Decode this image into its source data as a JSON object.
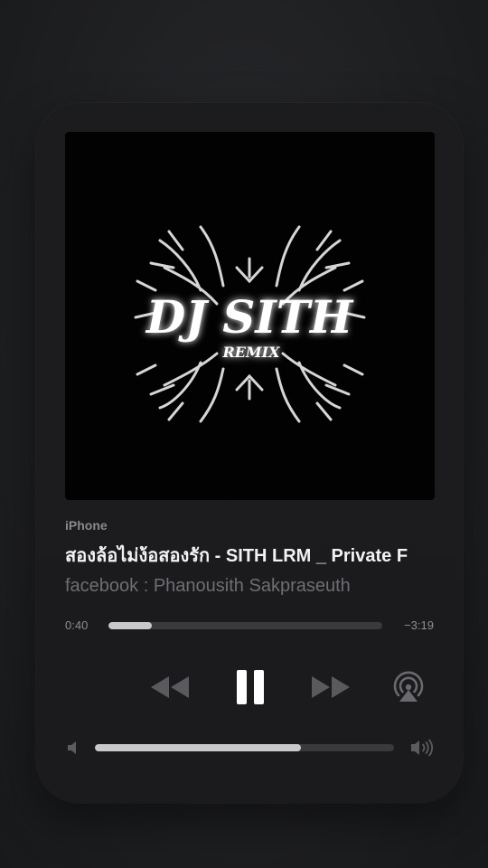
{
  "player": {
    "device_label": "iPhone",
    "track_title": "สองล้อไม่ง้อสองรัก - SITH LRM _ Private F",
    "artist": "facebook : Phanousith Sakpraseuth",
    "elapsed": "0:40",
    "remaining": "−3:19",
    "progress_fraction": 0.16,
    "volume_fraction": 0.69
  },
  "artwork": {
    "logo_text": "DJ SITH",
    "logo_subtext": "REMIX"
  },
  "controls": {
    "rewind_icon": "rewind-icon",
    "pause_icon": "pause-icon",
    "forward_icon": "fast-forward-icon",
    "airplay_icon": "airplay-audio-icon",
    "volume_low_icon": "speaker-low-icon",
    "volume_high_icon": "speaker-high-icon"
  },
  "colors": {
    "card_bg": "#1c1c1e",
    "accent_text": "#f2f2f4",
    "secondary_text": "#6e6e73",
    "control_active": "#ffffff",
    "control_dim": "#5a5a5e"
  }
}
